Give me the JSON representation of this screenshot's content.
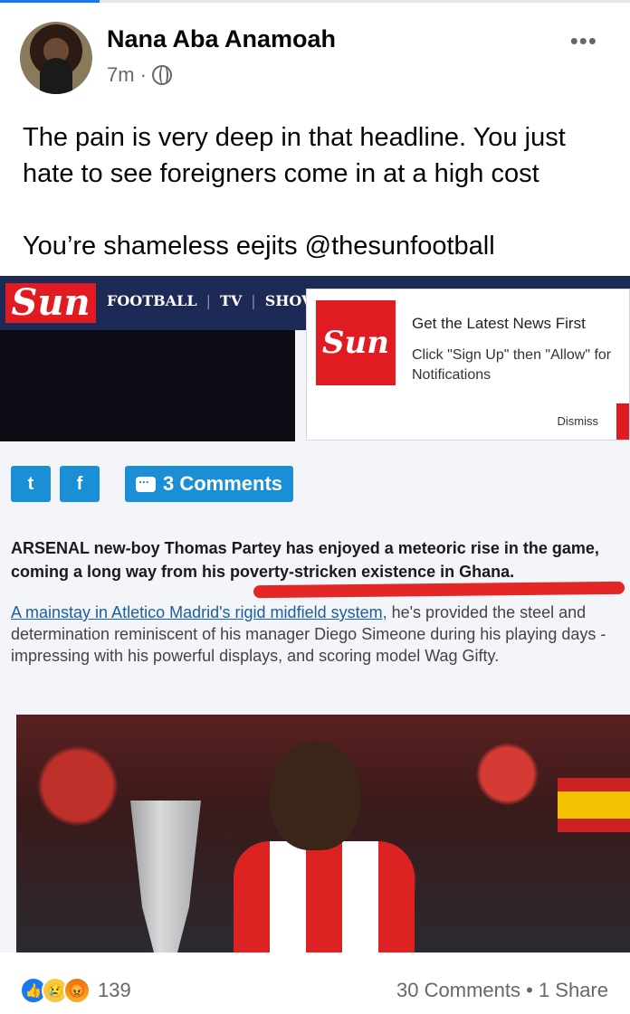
{
  "post": {
    "author": "Nana Aba Anamoah",
    "time": "7m",
    "time_sep": "·",
    "more_label": "•••",
    "text_line1": "The pain is very deep in that headline. You just hate to see foreigners come in at a high cost",
    "text_line2": "You’re shameless eejits @thesunfootball"
  },
  "article": {
    "logo": "Sun",
    "nav": [
      "FOOTBALL",
      "TV",
      "SHOV"
    ],
    "popup": {
      "logo": "Sun",
      "title": "Get the Latest News First",
      "body": "Click \"Sign Up\" then \"Allow\" for Notifications",
      "dismiss": "Dismiss"
    },
    "share": {
      "twitter_icon": "twitter-icon",
      "facebook_icon": "facebook-icon",
      "comments_label": "3 Comments"
    },
    "lead": "ARSENAL new-boy Thomas Partey has enjoyed a meteoric rise in the game, coming a long way from his poverty-stricken existence in Ghana.",
    "body_link": "A mainstay in Atletico Madrid's rigid midfield system,",
    "body_rest": " he's provided the steel and determination reminiscent of his manager Diego Simeone during his playing days - impressing with his powerful displays, and scoring model Wag Gifty."
  },
  "footer": {
    "reaction_count": "139",
    "comments": "30 Comments",
    "separator": "•",
    "shares": "1 Share"
  },
  "colors": {
    "facebook_blue": "#1877f2",
    "sun_red": "#e01b22",
    "underline_red": "#e32626"
  }
}
